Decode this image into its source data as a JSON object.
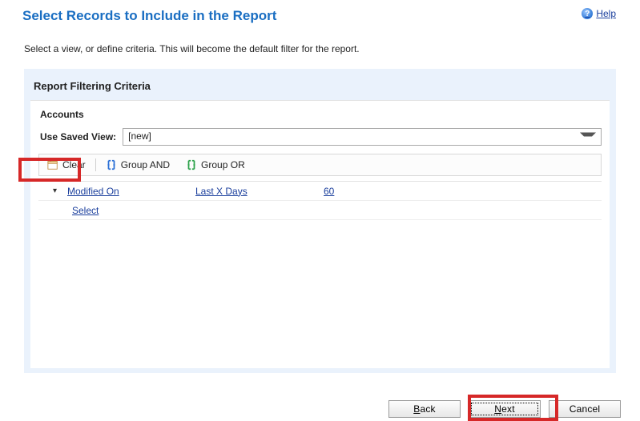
{
  "header": {
    "title": "Select Records to Include in the Report",
    "help": "Help"
  },
  "description": "Select a view, or define criteria. This will become the default filter for the report.",
  "panel": {
    "title": "Report Filtering Criteria",
    "section": "Accounts",
    "saved_view_label": "Use Saved View:",
    "saved_view_value": "[new]"
  },
  "toolbar": {
    "clear": "Clear",
    "group_and": "Group AND",
    "group_or": "Group OR"
  },
  "criteria": {
    "rows": [
      {
        "field": "Modified On",
        "op": "Last X Days",
        "value": "60"
      }
    ],
    "select_label": "Select"
  },
  "footer": {
    "back": "Back",
    "next": "Next",
    "cancel": "Cancel"
  }
}
